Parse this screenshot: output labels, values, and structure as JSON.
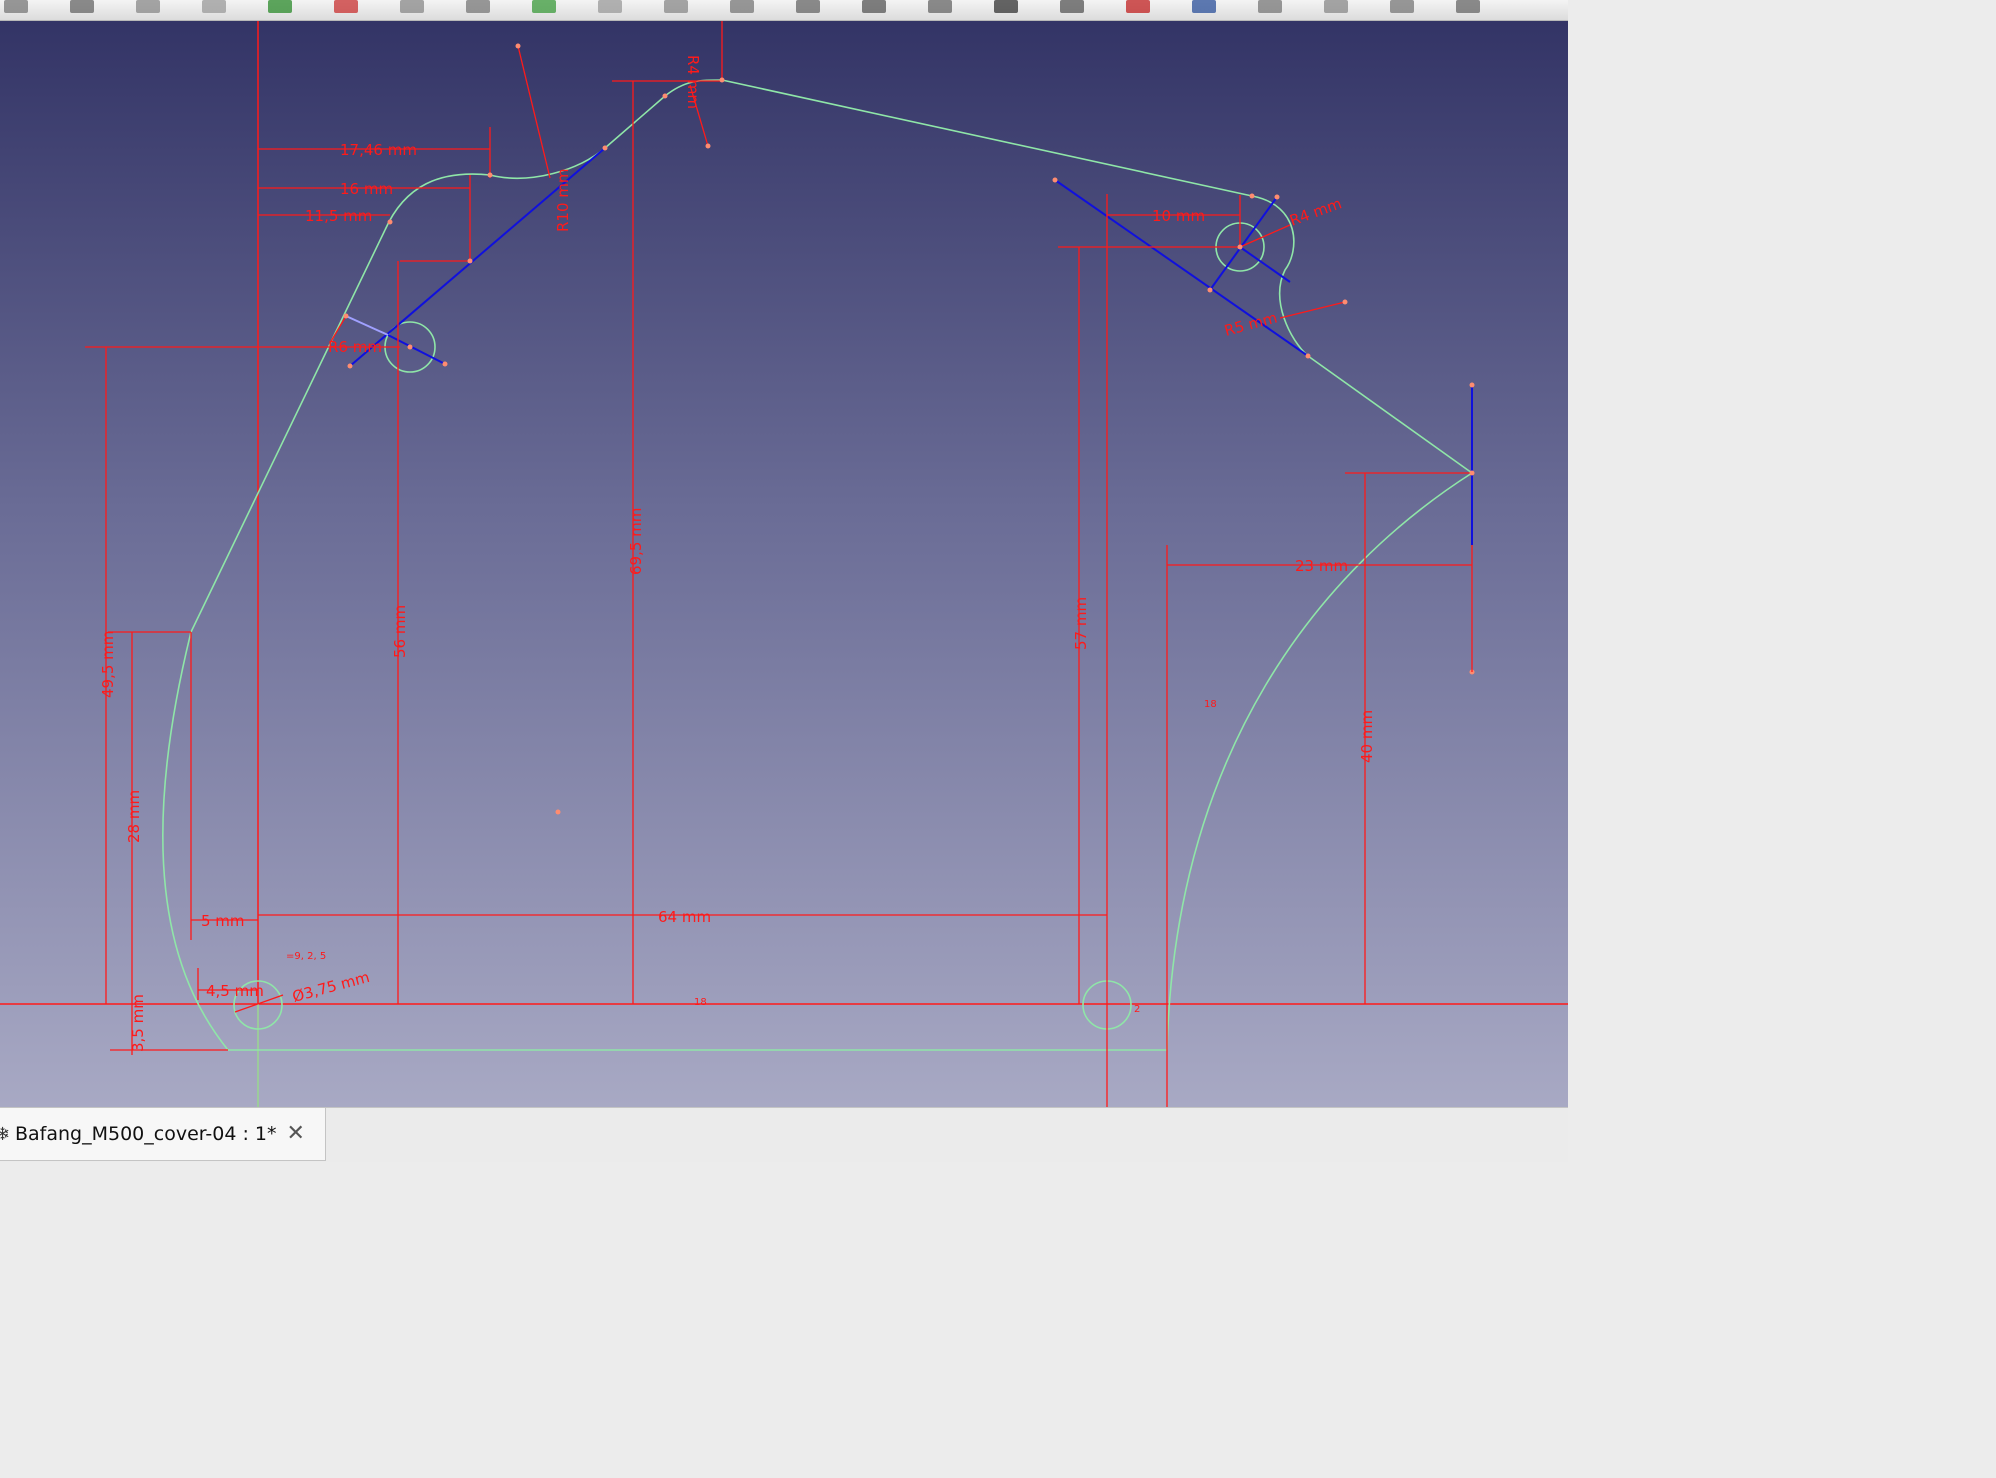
{
  "document_tab": {
    "label": "Bafang_M500_cover-04 : 1*",
    "close_icon": "close-icon",
    "doc_icon": "freecad-document-icon"
  },
  "toolbar": {
    "icons": [
      "part-icon",
      "assembly-icon",
      "constraint-icon",
      "arrow-icon",
      "sketch-icon",
      "line-icon",
      "polyline-icon",
      "arc-icon",
      "grid-icon",
      "spline-icon",
      "curve-icon",
      "fillet-icon",
      "trim-icon",
      "view-front-icon",
      "view-box-icon",
      "view-top-icon",
      "view-right-icon",
      "layer-icon",
      "window-icon",
      "clip-icon",
      "select-icon",
      "copy-icon",
      "settings-icon"
    ]
  },
  "colors": {
    "dimension": "#ff1a1a",
    "geometry": "#8fe6a8",
    "construction": "#1010dd",
    "background_top": "#333466",
    "background_bottom": "#a8a9c4"
  },
  "dimensions": {
    "d_17_46": "17,46 mm",
    "d_16": "16 mm",
    "d_11_5": "11,5 mm",
    "d_r10": "R10 mm",
    "d_69_5": "69,5 mm",
    "d_56": "56 mm",
    "d_57": "57 mm",
    "d_10": "10 mm",
    "d_r4": "R4 mm",
    "d_r5": "R5 mm",
    "d_49_5": "49,5 mm",
    "d_28": "28 mm",
    "d_5": "5 mm",
    "d_64": "64 mm",
    "d_4_5": "4,5 mm",
    "d_dia": "Ø3,75 mm",
    "d_3_5": "3,5 mm",
    "d_23": "23 mm",
    "d_40": "40 mm",
    "d_r6": "R6 mm",
    "d_r4b": "R4 mm"
  },
  "constraint_labels": {
    "c_9_2_5": "=9, 2, 5",
    "c_18": "18",
    "c_2": "2",
    "c_18b": "18"
  }
}
